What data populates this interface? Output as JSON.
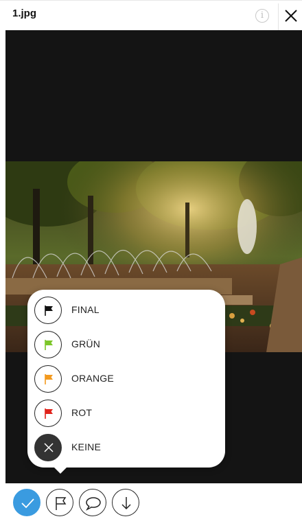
{
  "header": {
    "filename": "1.jpg",
    "info_icon": "info-icon",
    "close_icon": "close-icon"
  },
  "flag_menu": {
    "items": [
      {
        "label": "FINAL",
        "icon": "flag-icon",
        "color": "#111111"
      },
      {
        "label": "GRÜN",
        "icon": "flag-icon",
        "color": "#7cc62a"
      },
      {
        "label": "ORANGE",
        "icon": "flag-icon",
        "color": "#f39a1e"
      },
      {
        "label": "ROT",
        "icon": "flag-icon",
        "color": "#e0231b"
      },
      {
        "label": "KEINE",
        "icon": "close-icon",
        "color": "#333333"
      }
    ]
  },
  "toolbar": {
    "buttons": [
      {
        "icon": "checkmark-icon",
        "color": "#3a9be0"
      },
      {
        "icon": "flag-outline-icon"
      },
      {
        "icon": "comment-icon"
      },
      {
        "icon": "download-icon"
      }
    ]
  },
  "colors": {
    "viewer_background": "#141414",
    "accent": "#3a9be0"
  }
}
